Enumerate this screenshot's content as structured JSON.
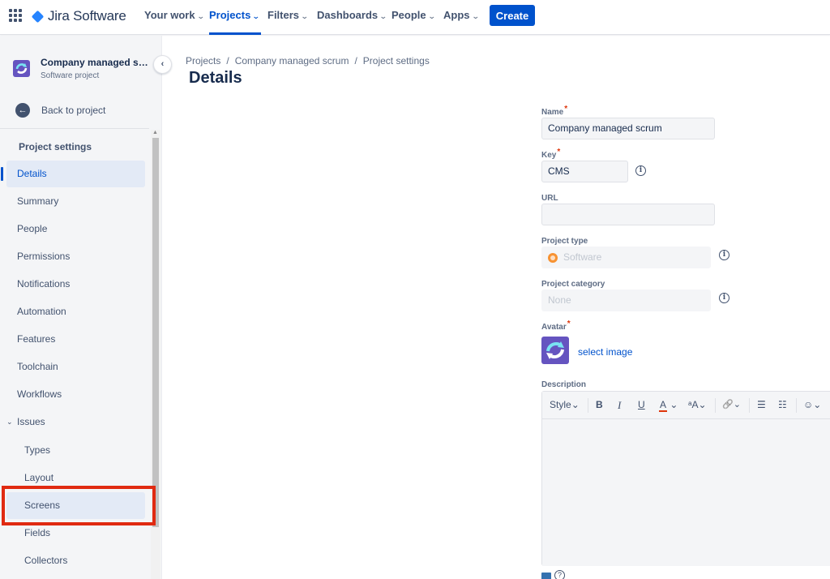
{
  "nav": {
    "logo_text": "Jira Software",
    "items": [
      {
        "label": "Your work",
        "chev": "⌄"
      },
      {
        "label": "Projects",
        "chev": "⌄"
      },
      {
        "label": "Filters",
        "chev": "⌄"
      },
      {
        "label": "Dashboards",
        "chev": "⌄"
      },
      {
        "label": "People",
        "chev": "⌄"
      },
      {
        "label": "Apps",
        "chev": "⌄"
      }
    ],
    "create_label": "Create"
  },
  "sidebar": {
    "project_name": "Company managed scr...",
    "project_type": "Software project",
    "back_label": "Back to project",
    "heading": "Project settings",
    "items": [
      {
        "label": "Details"
      },
      {
        "label": "Summary"
      },
      {
        "label": "People"
      },
      {
        "label": "Permissions"
      },
      {
        "label": "Notifications"
      },
      {
        "label": "Automation"
      },
      {
        "label": "Features"
      },
      {
        "label": "Toolchain"
      },
      {
        "label": "Workflows"
      },
      {
        "label": "Issues"
      },
      {
        "label": "Types"
      },
      {
        "label": "Layout"
      },
      {
        "label": "Screens"
      },
      {
        "label": "Fields"
      },
      {
        "label": "Collectors"
      }
    ]
  },
  "breadcrumb": {
    "items": [
      "Projects",
      "Company managed scrum",
      "Project settings"
    ],
    "separator": "/"
  },
  "page": {
    "title": "Details"
  },
  "form": {
    "required_mark": "*",
    "name_label": "Name",
    "name_value": "Company managed scrum",
    "key_label": "Key",
    "key_value": "CMS",
    "url_label": "URL",
    "url_value": "",
    "project_type_label": "Project type",
    "project_type_value": "Software",
    "project_category_label": "Project category",
    "project_category_value": "None",
    "avatar_label": "Avatar",
    "select_image_label": "select image",
    "description_label": "Description",
    "info_glyph": "i"
  },
  "editor_toolbar": {
    "style_label": "Style",
    "bold": "B",
    "italic": "I",
    "underline": "U",
    "text_color": "A",
    "more_format": "ᵃA",
    "link": "🔗",
    "bullet_list": "☰",
    "numbered_list": "☷",
    "emoji": "☺",
    "chev": "⌄"
  },
  "help": {
    "question": "?"
  },
  "colors": {
    "brand": "#0052cc",
    "highlight_box": "#e02a11",
    "sidebar_bg": "#f4f5f7"
  }
}
